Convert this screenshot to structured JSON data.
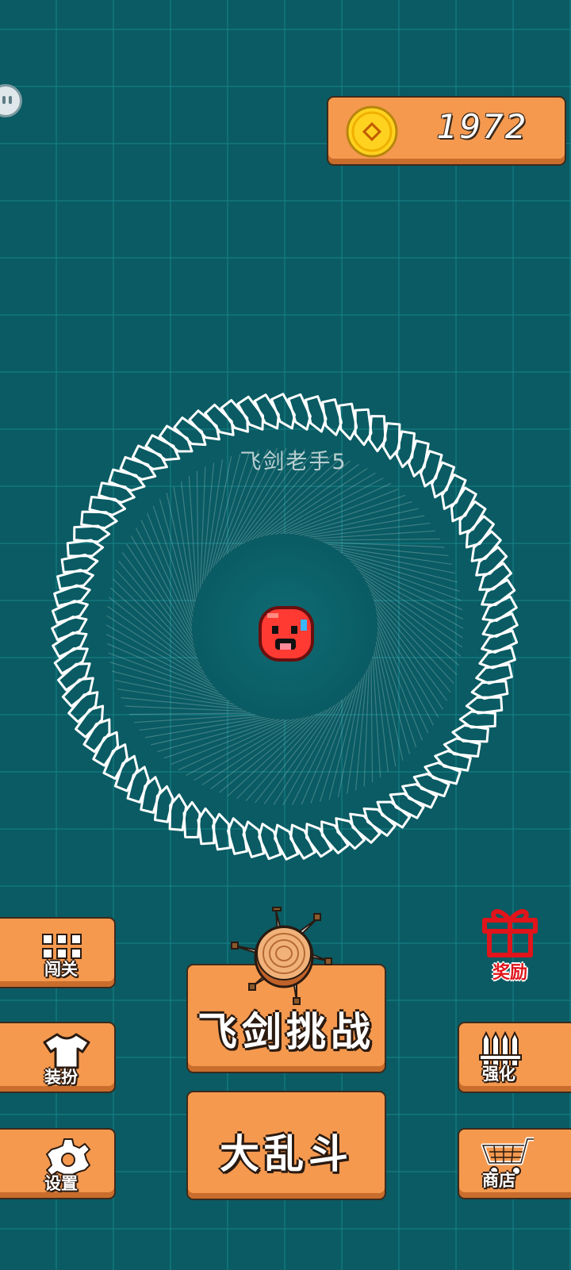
{
  "coins": {
    "value": "1972",
    "icon": "gold-coin-icon"
  },
  "level": {
    "title": "飞剑老手5"
  },
  "player": {
    "icon": "red-blob-face-icon"
  },
  "side_buttons": {
    "levels": {
      "label": "闯关",
      "icon": "grid-icon"
    },
    "costume": {
      "label": "装扮",
      "icon": "shirt-icon"
    },
    "settings": {
      "label": "设置",
      "icon": "gear-icon"
    },
    "upgrade": {
      "label": "强化",
      "icon": "swords-icon"
    },
    "shop": {
      "label": "商店",
      "icon": "cart-icon"
    }
  },
  "main_buttons": {
    "challenge": {
      "label": "飞剑挑战",
      "icon": "log-with-swords-icon"
    },
    "brawl": {
      "label": "大乱斗"
    }
  },
  "reward": {
    "label": "奖励",
    "icon": "gift-icon"
  },
  "colors": {
    "background": "#0a5b63",
    "button": "#f5994f",
    "button_shadow": "#c96d2c",
    "reward_red": "#e0141a",
    "coin_gold": "#ffd21f"
  }
}
